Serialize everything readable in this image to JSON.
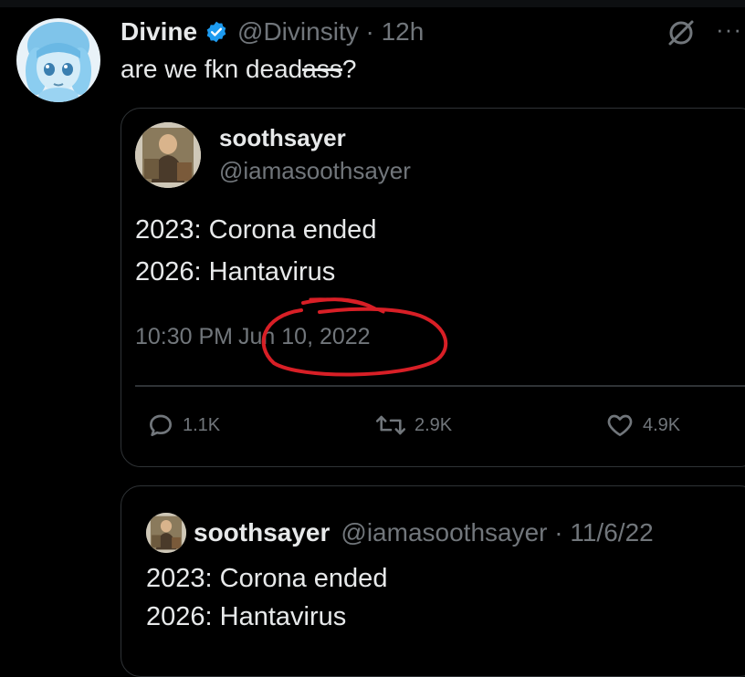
{
  "tweet": {
    "display_name": "Divine",
    "handle_time": "@Divinsity · 12h",
    "text_before": "are we fkn dead",
    "text_struck": "ass",
    "text_after": "?"
  },
  "quote": {
    "display_name": "soothsayer",
    "handle": "@iamasoothsayer",
    "lines": [
      "2023: Corona ended",
      "2026: Hantavirus"
    ],
    "time": "10:30 PM",
    "date": "Jun 10, 2022",
    "stats": {
      "replies": "1.1K",
      "retweets": "2.9K",
      "likes": "4.9K"
    }
  },
  "quote2": {
    "display_name": "soothsayer",
    "meta": "@iamasoothsayer · 11/6/22",
    "lines": [
      "2023: Corona ended",
      "2026: Hantavirus"
    ]
  },
  "colors": {
    "background": "#000000",
    "text_primary": "#e7e9ea",
    "text_secondary": "#71767b",
    "verified_blue": "#1d9bf0",
    "annotation_red": "#d81f26",
    "border": "#2f3336"
  }
}
